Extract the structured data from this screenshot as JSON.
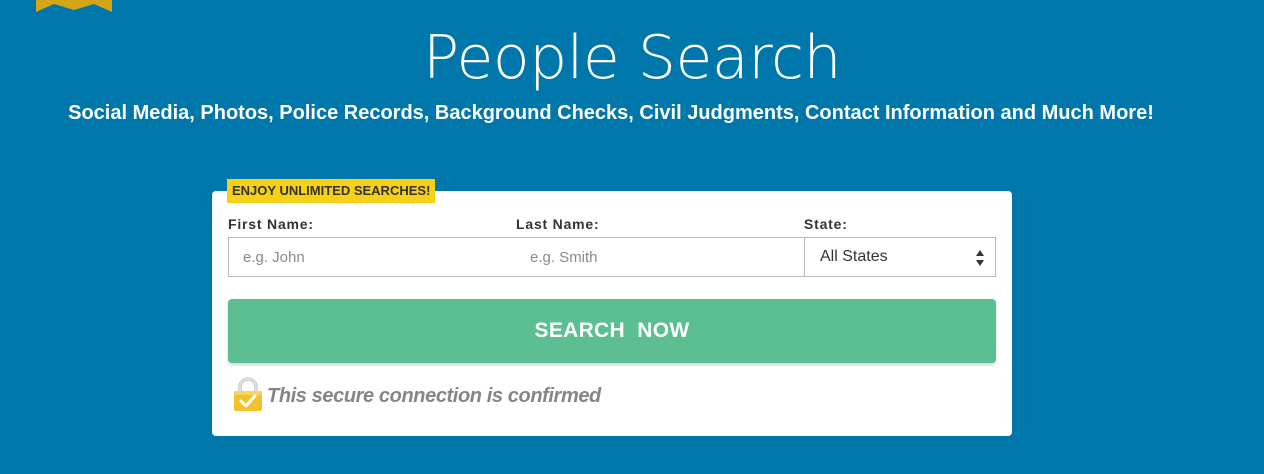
{
  "header": {
    "title": "People Search",
    "subtitle": "Social Media, Photos, Police Records, Background Checks, Civil Judgments, Contact Information and Much More!"
  },
  "search_form": {
    "badge": "ENJOY UNLIMITED SEARCHES!",
    "first_name": {
      "label": "First Name:",
      "placeholder": "e.g. John",
      "value": ""
    },
    "last_name": {
      "label": "Last Name:",
      "placeholder": "e.g. Smith",
      "value": ""
    },
    "state": {
      "label": "State:",
      "selected": "All States"
    },
    "button_label": "SEARCH  NOW",
    "secure_text": "This secure connection is confirmed"
  },
  "colors": {
    "background": "#0077aa",
    "badge": "#f7d117",
    "button": "#5bbf93",
    "ribbon": "#d4a514",
    "lock": "#f2c22c"
  }
}
